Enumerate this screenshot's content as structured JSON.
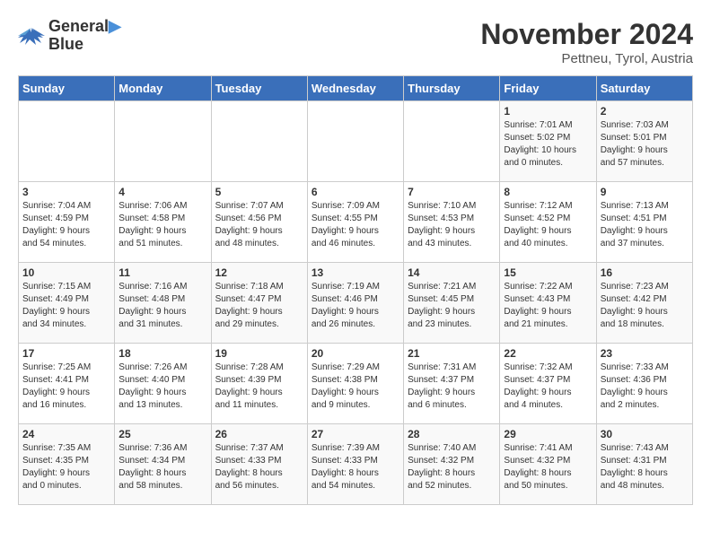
{
  "logo": {
    "line1": "General",
    "line2": "Blue"
  },
  "title": "November 2024",
  "location": "Pettneu, Tyrol, Austria",
  "weekdays": [
    "Sunday",
    "Monday",
    "Tuesday",
    "Wednesday",
    "Thursday",
    "Friday",
    "Saturday"
  ],
  "weeks": [
    [
      {
        "day": "",
        "info": ""
      },
      {
        "day": "",
        "info": ""
      },
      {
        "day": "",
        "info": ""
      },
      {
        "day": "",
        "info": ""
      },
      {
        "day": "",
        "info": ""
      },
      {
        "day": "1",
        "info": "Sunrise: 7:01 AM\nSunset: 5:02 PM\nDaylight: 10 hours\nand 0 minutes."
      },
      {
        "day": "2",
        "info": "Sunrise: 7:03 AM\nSunset: 5:01 PM\nDaylight: 9 hours\nand 57 minutes."
      }
    ],
    [
      {
        "day": "3",
        "info": "Sunrise: 7:04 AM\nSunset: 4:59 PM\nDaylight: 9 hours\nand 54 minutes."
      },
      {
        "day": "4",
        "info": "Sunrise: 7:06 AM\nSunset: 4:58 PM\nDaylight: 9 hours\nand 51 minutes."
      },
      {
        "day": "5",
        "info": "Sunrise: 7:07 AM\nSunset: 4:56 PM\nDaylight: 9 hours\nand 48 minutes."
      },
      {
        "day": "6",
        "info": "Sunrise: 7:09 AM\nSunset: 4:55 PM\nDaylight: 9 hours\nand 46 minutes."
      },
      {
        "day": "7",
        "info": "Sunrise: 7:10 AM\nSunset: 4:53 PM\nDaylight: 9 hours\nand 43 minutes."
      },
      {
        "day": "8",
        "info": "Sunrise: 7:12 AM\nSunset: 4:52 PM\nDaylight: 9 hours\nand 40 minutes."
      },
      {
        "day": "9",
        "info": "Sunrise: 7:13 AM\nSunset: 4:51 PM\nDaylight: 9 hours\nand 37 minutes."
      }
    ],
    [
      {
        "day": "10",
        "info": "Sunrise: 7:15 AM\nSunset: 4:49 PM\nDaylight: 9 hours\nand 34 minutes."
      },
      {
        "day": "11",
        "info": "Sunrise: 7:16 AM\nSunset: 4:48 PM\nDaylight: 9 hours\nand 31 minutes."
      },
      {
        "day": "12",
        "info": "Sunrise: 7:18 AM\nSunset: 4:47 PM\nDaylight: 9 hours\nand 29 minutes."
      },
      {
        "day": "13",
        "info": "Sunrise: 7:19 AM\nSunset: 4:46 PM\nDaylight: 9 hours\nand 26 minutes."
      },
      {
        "day": "14",
        "info": "Sunrise: 7:21 AM\nSunset: 4:45 PM\nDaylight: 9 hours\nand 23 minutes."
      },
      {
        "day": "15",
        "info": "Sunrise: 7:22 AM\nSunset: 4:43 PM\nDaylight: 9 hours\nand 21 minutes."
      },
      {
        "day": "16",
        "info": "Sunrise: 7:23 AM\nSunset: 4:42 PM\nDaylight: 9 hours\nand 18 minutes."
      }
    ],
    [
      {
        "day": "17",
        "info": "Sunrise: 7:25 AM\nSunset: 4:41 PM\nDaylight: 9 hours\nand 16 minutes."
      },
      {
        "day": "18",
        "info": "Sunrise: 7:26 AM\nSunset: 4:40 PM\nDaylight: 9 hours\nand 13 minutes."
      },
      {
        "day": "19",
        "info": "Sunrise: 7:28 AM\nSunset: 4:39 PM\nDaylight: 9 hours\nand 11 minutes."
      },
      {
        "day": "20",
        "info": "Sunrise: 7:29 AM\nSunset: 4:38 PM\nDaylight: 9 hours\nand 9 minutes."
      },
      {
        "day": "21",
        "info": "Sunrise: 7:31 AM\nSunset: 4:37 PM\nDaylight: 9 hours\nand 6 minutes."
      },
      {
        "day": "22",
        "info": "Sunrise: 7:32 AM\nSunset: 4:37 PM\nDaylight: 9 hours\nand 4 minutes."
      },
      {
        "day": "23",
        "info": "Sunrise: 7:33 AM\nSunset: 4:36 PM\nDaylight: 9 hours\nand 2 minutes."
      }
    ],
    [
      {
        "day": "24",
        "info": "Sunrise: 7:35 AM\nSunset: 4:35 PM\nDaylight: 9 hours\nand 0 minutes."
      },
      {
        "day": "25",
        "info": "Sunrise: 7:36 AM\nSunset: 4:34 PM\nDaylight: 8 hours\nand 58 minutes."
      },
      {
        "day": "26",
        "info": "Sunrise: 7:37 AM\nSunset: 4:33 PM\nDaylight: 8 hours\nand 56 minutes."
      },
      {
        "day": "27",
        "info": "Sunrise: 7:39 AM\nSunset: 4:33 PM\nDaylight: 8 hours\nand 54 minutes."
      },
      {
        "day": "28",
        "info": "Sunrise: 7:40 AM\nSunset: 4:32 PM\nDaylight: 8 hours\nand 52 minutes."
      },
      {
        "day": "29",
        "info": "Sunrise: 7:41 AM\nSunset: 4:32 PM\nDaylight: 8 hours\nand 50 minutes."
      },
      {
        "day": "30",
        "info": "Sunrise: 7:43 AM\nSunset: 4:31 PM\nDaylight: 8 hours\nand 48 minutes."
      }
    ]
  ]
}
